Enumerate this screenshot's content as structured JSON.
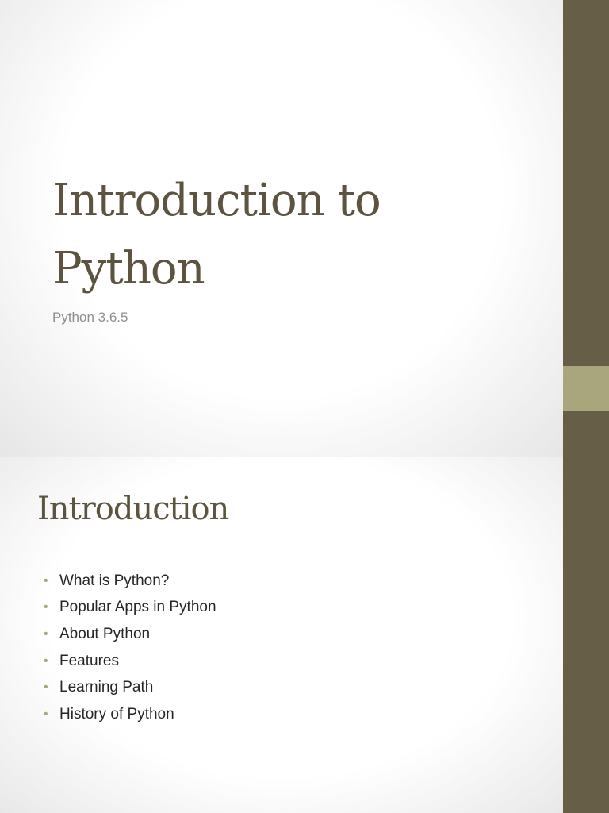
{
  "slides": [
    {
      "title": "Introduction to Python",
      "subtitle": "Python 3.6.5"
    },
    {
      "title": "Introduction",
      "bullets": [
        "What is Python?",
        "Popular Apps in Python",
        "About Python",
        "Features",
        "Learning Path",
        "History of Python"
      ]
    }
  ],
  "theme": {
    "sidebar_color": "#665e47",
    "accent_color": "#a9a67e",
    "title_color": "#5c5440"
  },
  "icons": {
    "bullet": "•"
  }
}
